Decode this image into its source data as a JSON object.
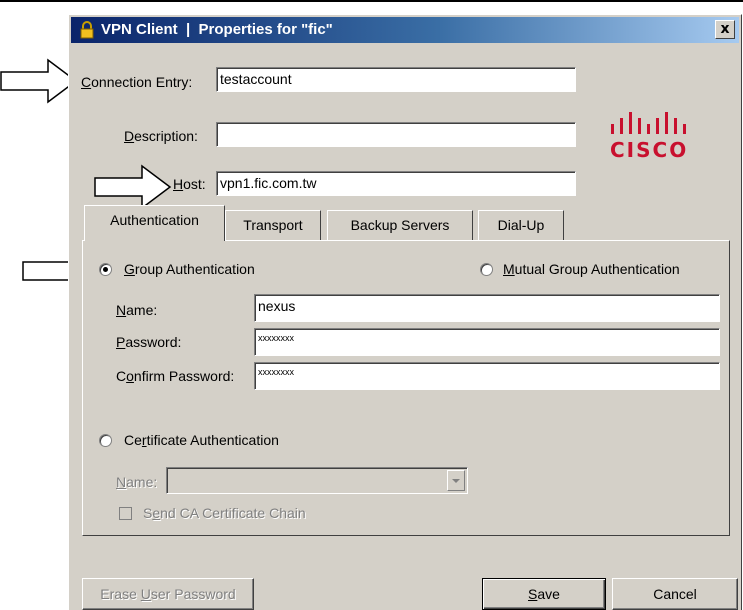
{
  "window": {
    "title": "VPN Client  |  Properties for \"fic\"",
    "close_label": "x"
  },
  "form": {
    "connection_entry": {
      "pre": "",
      "key": "C",
      "post": "onnection Entry:",
      "value": "testaccount"
    },
    "description": {
      "pre": "",
      "key": "D",
      "post": "escription:",
      "value": ""
    },
    "host": {
      "pre": "",
      "key": "H",
      "post": "ost:",
      "value": "vpn1.fic.com.tw"
    }
  },
  "logo": {
    "text": "cisco"
  },
  "tabs": [
    {
      "label": "Authentication"
    },
    {
      "label": "Transport"
    },
    {
      "label": "Backup Servers"
    },
    {
      "label": "Dial-Up"
    }
  ],
  "auth": {
    "group": {
      "pre": "",
      "key": "G",
      "post": "roup Authentication",
      "selected": true
    },
    "mutual": {
      "pre": "",
      "key": "M",
      "post": "utual Group Authentication",
      "selected": false
    },
    "name": {
      "pre": "",
      "key": "N",
      "post": "ame:",
      "value": "nexus"
    },
    "password": {
      "pre": "",
      "key": "P",
      "post": "assword:",
      "value": "xxxxxxxx"
    },
    "confirm": {
      "pre": "C",
      "key": "o",
      "post": "nfirm Password:",
      "value": "xxxxxxxx"
    },
    "certificate": {
      "pre": "Ce",
      "key": "r",
      "post": "tificate Authentication",
      "selected": false
    },
    "cert_name": {
      "pre": "",
      "key": "N",
      "post": "ame:",
      "value": ""
    },
    "send_ca": {
      "pre": "S",
      "key": "e",
      "post": "nd CA Certificate Chain",
      "checked": false
    }
  },
  "buttons": {
    "erase": {
      "pre": "Erase ",
      "key": "U",
      "post": "ser Password"
    },
    "save": {
      "pre": "",
      "key": "S",
      "post": "ave"
    },
    "cancel": {
      "label": "Cancel"
    }
  }
}
